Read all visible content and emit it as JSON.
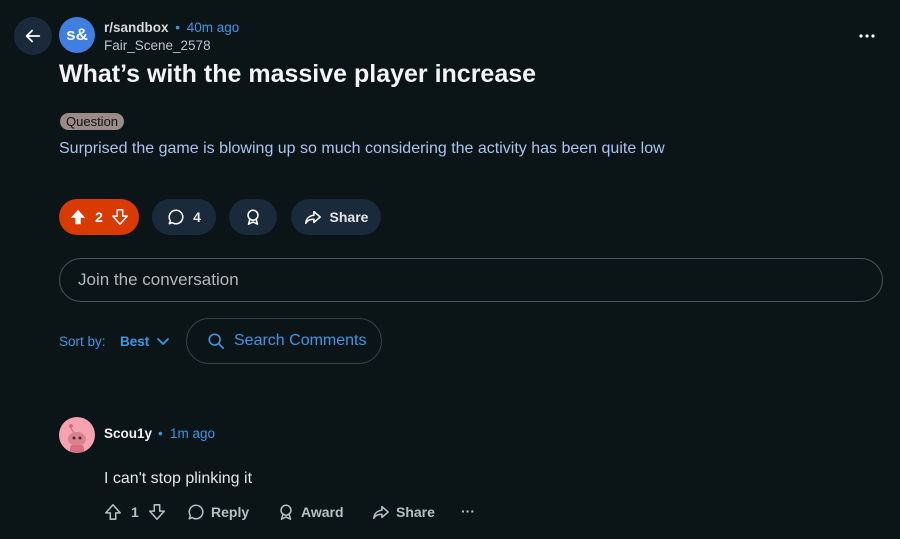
{
  "post": {
    "subreddit": "r/sandbox",
    "subreddit_avatar_text": "s&",
    "separator": "•",
    "time": "40m ago",
    "author": "Fair_Scene_2578",
    "title": "What’s with the massive player increase",
    "flair": "Question",
    "body": "Surprised the game is blowing up so much considering the activity has been quite low",
    "score": "2",
    "comments": "4",
    "share_label": "Share"
  },
  "join": {
    "placeholder": "Join the conversation"
  },
  "sort": {
    "label": "Sort by:",
    "value": "Best"
  },
  "search": {
    "placeholder": "Search Comments"
  },
  "comment": {
    "author": "Scou1y",
    "separator": "•",
    "time": "1m ago",
    "text": "I can't stop plinking it",
    "score": "1",
    "reply_label": "Reply",
    "award_label": "Award",
    "share_label": "Share",
    "more": "···"
  },
  "colors": {
    "background": "#0b1416",
    "upvoted": "#d93a00",
    "accent": "#3b98e6",
    "pill": "#1a2a3a"
  },
  "icons": [
    "back-arrow-icon",
    "more-icon",
    "upvote-icon",
    "downvote-icon",
    "comment-icon",
    "award-icon",
    "share-icon",
    "search-icon",
    "chevron-down-icon"
  ]
}
